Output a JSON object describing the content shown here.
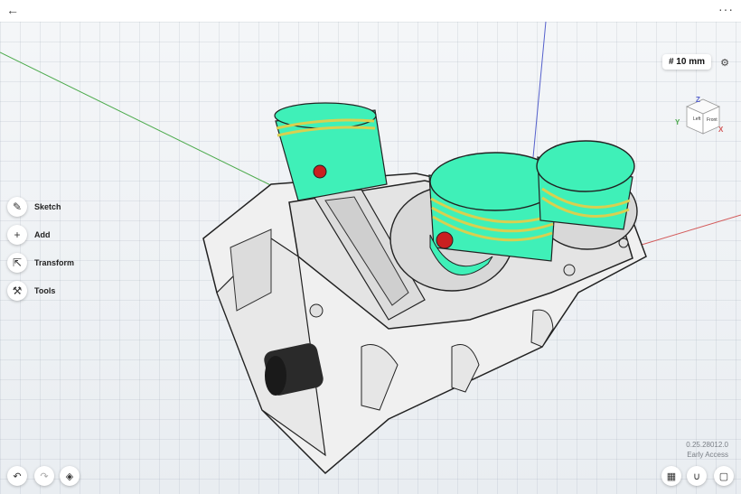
{
  "titlebar": {
    "back_icon": "←",
    "more_icon": "···"
  },
  "toolbar": {
    "items": [
      {
        "label": "Sketch",
        "icon": "✎"
      },
      {
        "label": "Add",
        "icon": "+"
      },
      {
        "label": "Transform",
        "icon": "⇱"
      },
      {
        "label": "Tools",
        "icon": "⚒"
      }
    ]
  },
  "scale": {
    "label": "# 10 mm"
  },
  "viewcube": {
    "top": "Z",
    "left": "Left",
    "front": "Front",
    "x_axis": "X",
    "y_axis": "Y"
  },
  "version": {
    "number": "0.25.28012.0",
    "channel": "Early Access"
  },
  "bottom": {
    "undo_icon": "↶",
    "redo_icon": "↷",
    "layers_icon": "◈",
    "display_icon": "▦",
    "snap_icon": "∪",
    "frame_icon": "▢"
  },
  "colors": {
    "piston": "#3ff0b8",
    "ring": "#e8e060",
    "housing": "#f2f2f2",
    "axis_x": "#d35a5a",
    "axis_y": "#4caa4c",
    "axis_z": "#5560cc"
  }
}
